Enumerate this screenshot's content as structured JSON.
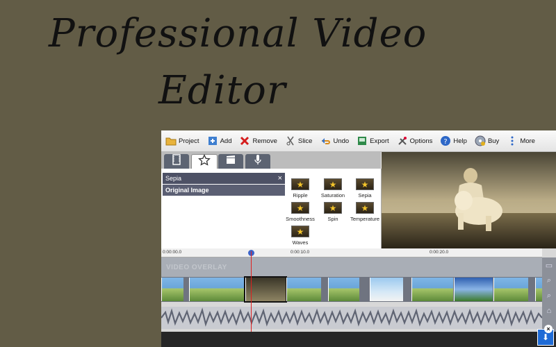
{
  "headline": {
    "line1": "Professional Video",
    "line2": "Editor"
  },
  "toolbar": {
    "items": [
      {
        "label": "Project",
        "icon": "folder-icon"
      },
      {
        "label": "Add",
        "icon": "add-media-icon"
      },
      {
        "label": "Remove",
        "icon": "remove-x-icon"
      },
      {
        "label": "Slice",
        "icon": "slice-icon"
      },
      {
        "label": "Undo",
        "icon": "undo-icon"
      },
      {
        "label": "Export",
        "icon": "export-icon"
      },
      {
        "label": "Options",
        "icon": "options-tools-icon"
      },
      {
        "label": "Help",
        "icon": "help-icon"
      },
      {
        "label": "Buy",
        "icon": "buy-disc-icon"
      },
      {
        "label": "More",
        "icon": "more-vertical-icon"
      }
    ]
  },
  "tabs": [
    {
      "icon": "film-strip-icon",
      "active": false
    },
    {
      "icon": "star-icon",
      "active": true
    },
    {
      "icon": "clapperboard-icon",
      "active": false
    },
    {
      "icon": "microphone-icon",
      "active": false
    }
  ],
  "effects_list": {
    "selected": "Sepia",
    "original": "Original Image",
    "close_glyph": "×"
  },
  "effects": [
    "Ripple",
    "Saturation",
    "Sepia",
    "Smoothness",
    "Spin",
    "Temperature",
    "Waves"
  ],
  "timeline": {
    "ruler_marks": [
      "0:00:00.0",
      "0:00:10.0",
      "0:00:20.0"
    ],
    "overlay_label": "VIDEO OVERLAY"
  },
  "colors": {
    "accent": "#3d64c9",
    "playhead": "#e02020",
    "download": "#1f6bd6"
  }
}
